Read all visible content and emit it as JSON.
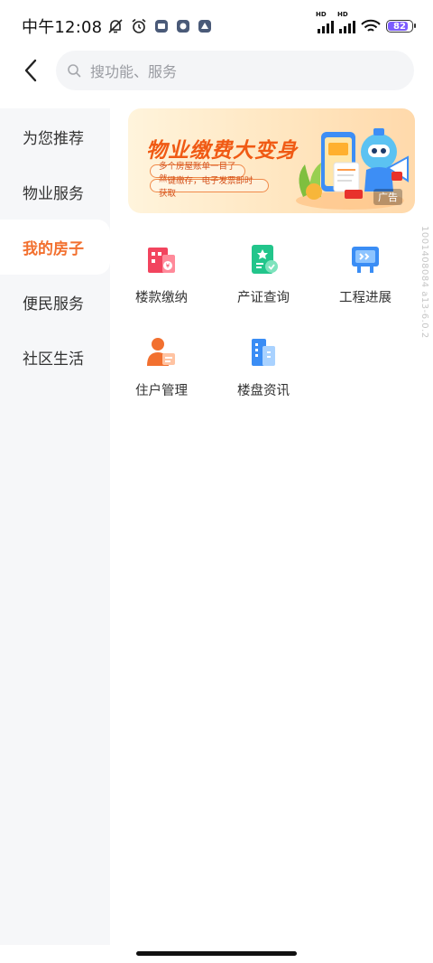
{
  "status_bar": {
    "time": "中午12:08",
    "battery": "82",
    "signal_labels": [
      "HD",
      "HD"
    ]
  },
  "header": {
    "search_placeholder": "搜功能、服务"
  },
  "sidebar": {
    "items": [
      {
        "label": "为您推荐",
        "active": false
      },
      {
        "label": "物业服务",
        "active": false
      },
      {
        "label": "我的房子",
        "active": true
      },
      {
        "label": "便民服务",
        "active": false
      },
      {
        "label": "社区生活",
        "active": false
      }
    ]
  },
  "banner": {
    "title": "物业缴费大变身",
    "line1": "多个房屋账单一目了然",
    "line2": "一键缴存，电子发票即时获取",
    "ad_label": "广告"
  },
  "services": [
    {
      "label": "楼款缴纳",
      "icon": "building-payment-icon",
      "color": "#f2445e"
    },
    {
      "label": "产证查询",
      "icon": "certificate-icon",
      "color": "#22c58b"
    },
    {
      "label": "工程进展",
      "icon": "progress-board-icon",
      "color": "#3a8df5"
    },
    {
      "label": "住户管理",
      "icon": "resident-icon",
      "color": "#f2702f"
    },
    {
      "label": "楼盘资讯",
      "icon": "building-info-icon",
      "color": "#3a8df5"
    }
  ],
  "watermark": "1001408084 a13-6.0.2",
  "colors": {
    "accent": "#f2702f",
    "sidebar_bg": "#f6f7f9",
    "search_bg": "#f4f5f7"
  }
}
